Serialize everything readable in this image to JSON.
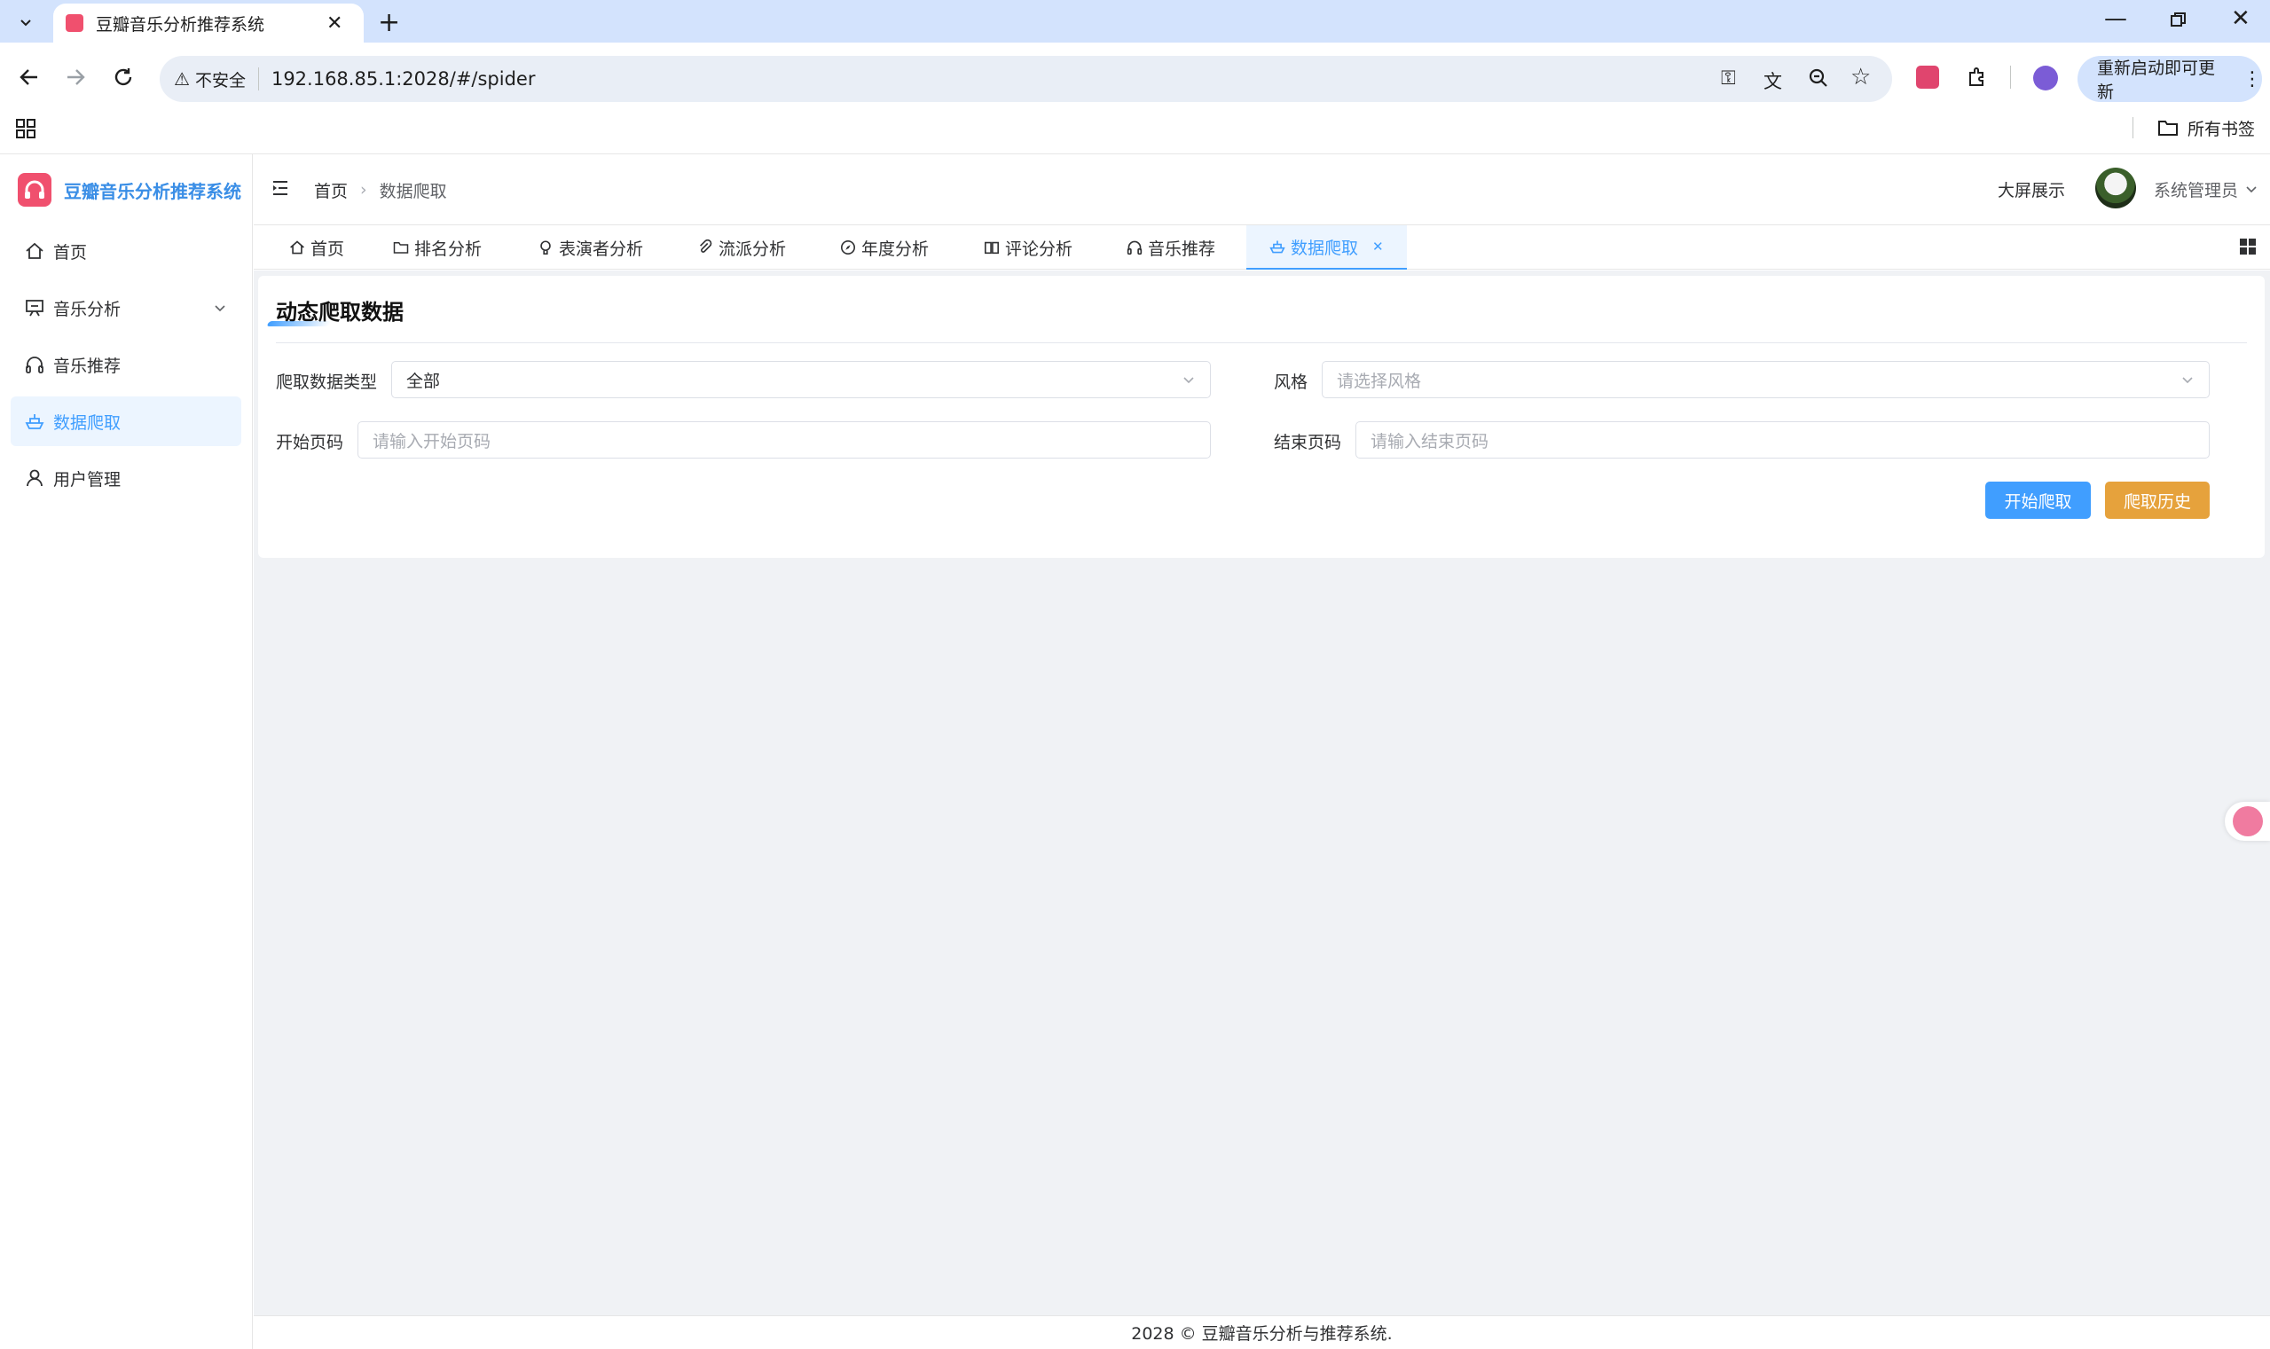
{
  "browser": {
    "tab_title": "豆瓣音乐分析推荐系统",
    "security_label": "不安全",
    "url": "192.168.85.1:2028/#/spider",
    "update_label": "重新启动即可更新",
    "all_bookmarks": "所有书签"
  },
  "app": {
    "title": "豆瓣音乐分析推荐系统",
    "accent_color": "#409eff",
    "sidebar": {
      "items": [
        {
          "label": "首页",
          "icon": "home-icon"
        },
        {
          "label": "音乐分析",
          "icon": "easel-icon"
        },
        {
          "label": "音乐推荐",
          "icon": "headphones-icon"
        },
        {
          "label": "数据爬取",
          "icon": "ship-icon"
        },
        {
          "label": "用户管理",
          "icon": "user-icon"
        }
      ]
    },
    "header": {
      "breadcrumb": [
        "首页",
        "数据爬取"
      ],
      "big_screen": "大屏展示",
      "user_name": "系统管理员"
    },
    "tags": [
      {
        "label": "首页"
      },
      {
        "label": "排名分析"
      },
      {
        "label": "表演者分析"
      },
      {
        "label": "流派分析"
      },
      {
        "label": "年度分析"
      },
      {
        "label": "评论分析"
      },
      {
        "label": "音乐推荐"
      },
      {
        "label": "数据爬取"
      }
    ],
    "form": {
      "title": "动态爬取数据",
      "type_label": "爬取数据类型",
      "type_value": "全部",
      "style_label": "风格",
      "style_placeholder": "请选择风格",
      "start_label": "开始页码",
      "start_placeholder": "请输入开始页码",
      "end_label": "结束页码",
      "end_placeholder": "请输入结束页码",
      "start_button": "开始爬取",
      "history_button": "爬取历史"
    },
    "footer": "2028 © 豆瓣音乐分析与推荐系统."
  }
}
